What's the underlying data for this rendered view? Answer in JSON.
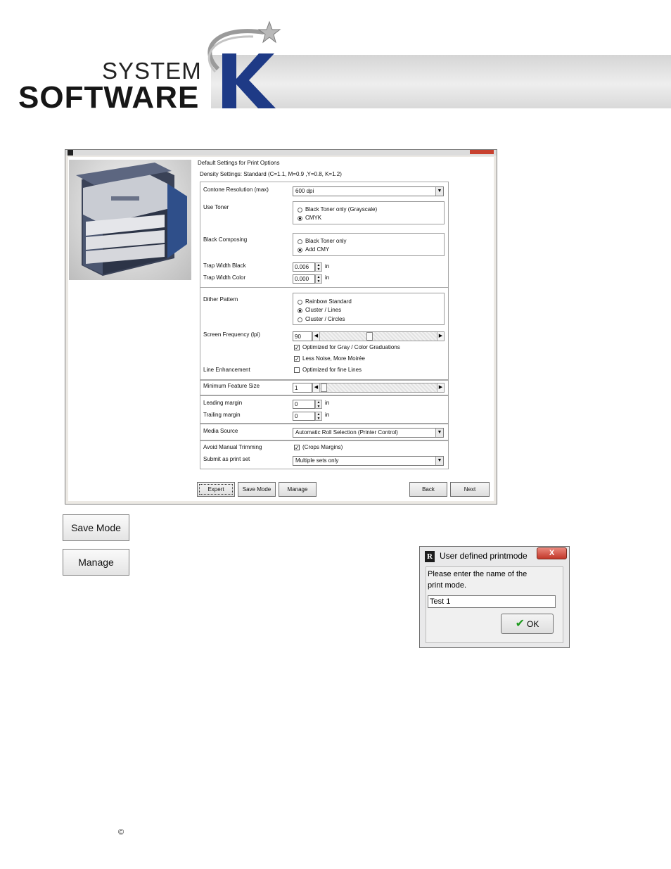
{
  "logo": {
    "line1": "SYSTEM",
    "line2": "SOFTWARE",
    "mark": "K"
  },
  "window": {
    "header": "Default Settings for Print Options",
    "density": "Density Settings: Standard (C=1.1, M=0.9 ,Y=0.8, K=1.2)",
    "contone": {
      "label": "Contone Resolution (max)",
      "value": "600 dpi"
    },
    "use_toner": {
      "label": "Use Toner",
      "options": [
        "Black Toner only (Grayscale)",
        "CMYK"
      ],
      "selected": 1
    },
    "black_composing": {
      "label": "Black Composing",
      "options": [
        "Black Toner only",
        "Add CMY"
      ],
      "selected": 1
    },
    "trap_black": {
      "label": "Trap Width Black",
      "value": "0.006",
      "unit": "in"
    },
    "trap_color": {
      "label": "Trap Width Color",
      "value": "0.000",
      "unit": "in"
    },
    "dither": {
      "label": "Dither Pattern",
      "options": [
        "Rainbow Standard",
        "Cluster / Lines",
        "Cluster / Circles"
      ],
      "selected": 1
    },
    "screen_frequency": {
      "label": "Screen Frequency (lpi)",
      "value": "90"
    },
    "opt_gray": {
      "label": "Optimized for Gray / Color Graduations",
      "checked": true
    },
    "less_noise": {
      "label": "Less Noise, More Moirée",
      "checked": true
    },
    "line_enh": {
      "label": "Line Enhancement",
      "check_label": "Optimized for fine Lines",
      "checked": false
    },
    "min_feature": {
      "label": "Minimum Feature Size",
      "value": "1"
    },
    "leading": {
      "label": "Leading margin",
      "value": "0",
      "unit": "in"
    },
    "trailing": {
      "label": "Trailing margin",
      "value": "0",
      "unit": "in"
    },
    "media": {
      "label": "Media Source",
      "value": "Automatic Roll Selection (Printer Control)"
    },
    "avoid_trim": {
      "label": "Avoid Manual Trimming",
      "check_label": "(Crops Margins)",
      "checked": true
    },
    "submit": {
      "label": "Submit as print set",
      "value": "Multiple sets only"
    },
    "buttons": {
      "expert": "Expert",
      "save_mode": "Save Mode",
      "manage": "Manage",
      "back": "Back",
      "next": "Next"
    }
  },
  "big_buttons": {
    "save_mode": "Save Mode",
    "manage": "Manage"
  },
  "dialog": {
    "title": "User defined printmode",
    "close": "X",
    "message_line1": "Please enter the name of the",
    "message_line2": "print mode.",
    "input_value": "Test 1",
    "ok": "OK"
  },
  "footer": {
    "copyright": "©"
  }
}
